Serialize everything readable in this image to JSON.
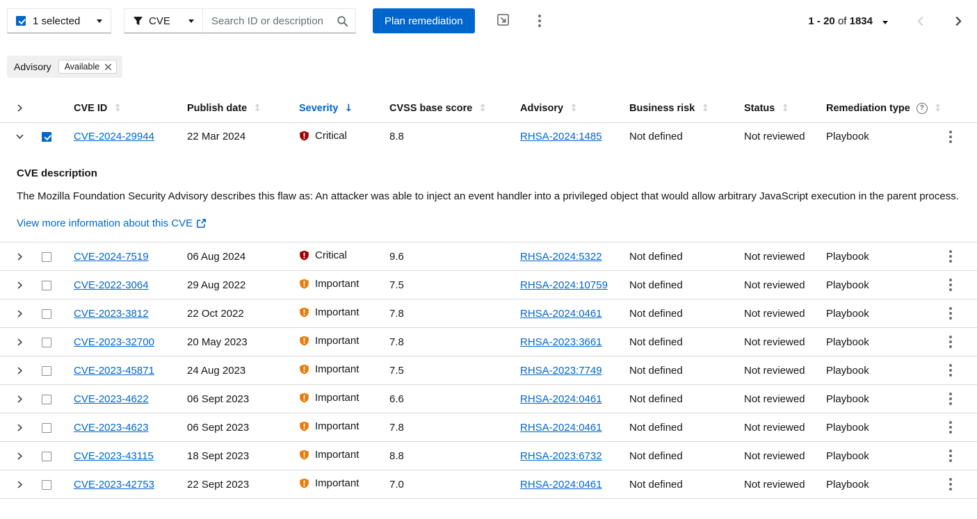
{
  "toolbar": {
    "bulk_select_label": "1 selected",
    "filter_dropdown_label": "CVE",
    "search_placeholder": "Search ID or description",
    "plan_remediation_label": "Plan remediation",
    "pagination": {
      "range": "1 - 20",
      "of_word": "of",
      "total": "1834"
    }
  },
  "filter_chips": {
    "group_label": "Advisory",
    "chip_label": "Available"
  },
  "table": {
    "headers": {
      "cve_id": "CVE ID",
      "publish_date": "Publish date",
      "severity": "Severity",
      "cvss": "CVSS base score",
      "advisory": "Advisory",
      "business_risk": "Business risk",
      "status": "Status",
      "remediation_type": "Remediation type"
    },
    "rows": [
      {
        "cve_id": "CVE-2024-29944",
        "publish_date": "22 Mar 2024",
        "severity": "Critical",
        "cvss": "8.8",
        "advisory": "RHSA-2024:1485",
        "business_risk": "Not defined",
        "status": "Not reviewed",
        "remediation": "Playbook",
        "expanded": true,
        "selected": true
      },
      {
        "cve_id": "CVE-2024-7519",
        "publish_date": "06 Aug 2024",
        "severity": "Critical",
        "cvss": "9.6",
        "advisory": "RHSA-2024:5322",
        "business_risk": "Not defined",
        "status": "Not reviewed",
        "remediation": "Playbook",
        "expanded": false,
        "selected": false
      },
      {
        "cve_id": "CVE-2022-3064",
        "publish_date": "29 Aug 2022",
        "severity": "Important",
        "cvss": "7.5",
        "advisory": "RHSA-2024:10759",
        "business_risk": "Not defined",
        "status": "Not reviewed",
        "remediation": "Playbook",
        "expanded": false,
        "selected": false
      },
      {
        "cve_id": "CVE-2023-3812",
        "publish_date": "22 Oct 2022",
        "severity": "Important",
        "cvss": "7.8",
        "advisory": "RHSA-2024:0461",
        "business_risk": "Not defined",
        "status": "Not reviewed",
        "remediation": "Playbook",
        "expanded": false,
        "selected": false
      },
      {
        "cve_id": "CVE-2023-32700",
        "publish_date": "20 May 2023",
        "severity": "Important",
        "cvss": "7.8",
        "advisory": "RHSA-2023:3661",
        "business_risk": "Not defined",
        "status": "Not reviewed",
        "remediation": "Playbook",
        "expanded": false,
        "selected": false
      },
      {
        "cve_id": "CVE-2023-45871",
        "publish_date": "24 Aug 2023",
        "severity": "Important",
        "cvss": "7.5",
        "advisory": "RHSA-2023:7749",
        "business_risk": "Not defined",
        "status": "Not reviewed",
        "remediation": "Playbook",
        "expanded": false,
        "selected": false
      },
      {
        "cve_id": "CVE-2023-4622",
        "publish_date": "06 Sept 2023",
        "severity": "Important",
        "cvss": "6.6",
        "advisory": "RHSA-2024:0461",
        "business_risk": "Not defined",
        "status": "Not reviewed",
        "remediation": "Playbook",
        "expanded": false,
        "selected": false
      },
      {
        "cve_id": "CVE-2023-4623",
        "publish_date": "06 Sept 2023",
        "severity": "Important",
        "cvss": "7.8",
        "advisory": "RHSA-2024:0461",
        "business_risk": "Not defined",
        "status": "Not reviewed",
        "remediation": "Playbook",
        "expanded": false,
        "selected": false
      },
      {
        "cve_id": "CVE-2023-43115",
        "publish_date": "18 Sept 2023",
        "severity": "Important",
        "cvss": "8.8",
        "advisory": "RHSA-2023:6732",
        "business_risk": "Not defined",
        "status": "Not reviewed",
        "remediation": "Playbook",
        "expanded": false,
        "selected": false
      },
      {
        "cve_id": "CVE-2023-42753",
        "publish_date": "22 Sept 2023",
        "severity": "Important",
        "cvss": "7.0",
        "advisory": "RHSA-2024:0461",
        "business_risk": "Not defined",
        "status": "Not reviewed",
        "remediation": "Playbook",
        "expanded": false,
        "selected": false
      }
    ],
    "detail": {
      "heading": "CVE description",
      "description": "The Mozilla Foundation Security Advisory describes this flaw as: An attacker was able to inject an event handler into a privileged object that would allow arbitrary JavaScript execution in the parent process.",
      "link_label": "View more information about this CVE"
    }
  },
  "severity_colors": {
    "Critical": "#a30000",
    "Important": "#ec7a08"
  },
  "accent_color": "#0066cc"
}
